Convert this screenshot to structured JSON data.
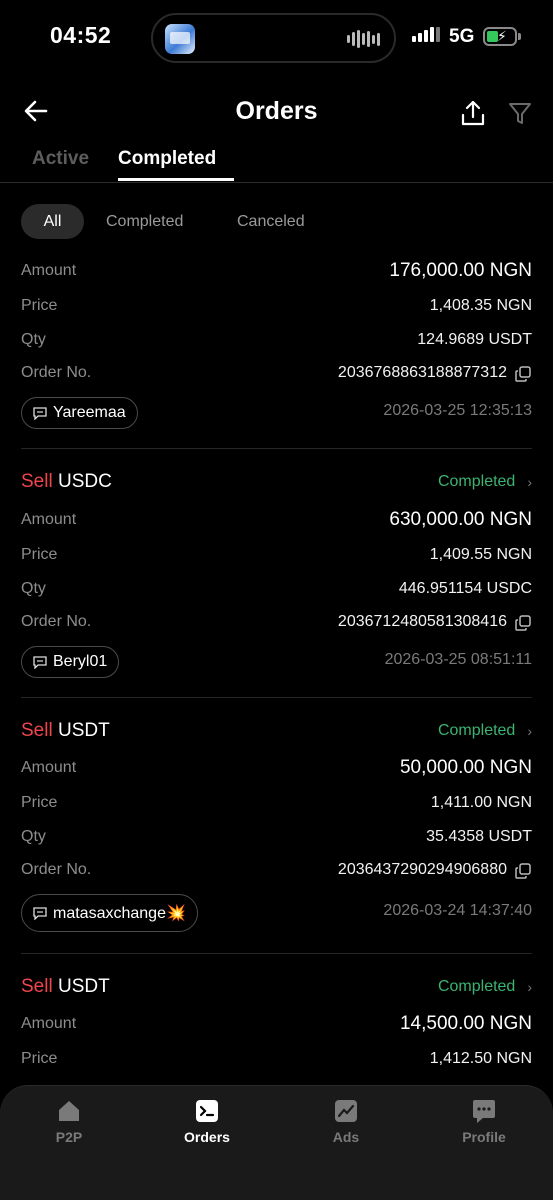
{
  "status_bar": {
    "time": "04:52",
    "network": "5G"
  },
  "header": {
    "title": "Orders"
  },
  "tabs": [
    {
      "label": "Active"
    },
    {
      "label": "Completed"
    }
  ],
  "chips": [
    {
      "label": "All"
    },
    {
      "label": "Completed"
    },
    {
      "label": "Canceled"
    }
  ],
  "labels": {
    "amount": "Amount",
    "price": "Price",
    "qty": "Qty",
    "order_no": "Order No."
  },
  "orders": [
    {
      "amount": "176,000.00 NGN",
      "price": "1,408.35 NGN",
      "qty": "124.9689 USDT",
      "order_no": "2036768863188877312",
      "merchant": "Yareemaa",
      "date": "2026-03-25 12:35:13"
    },
    {
      "side": "Sell",
      "asset": "USDC",
      "status": "Completed",
      "amount": "630,000.00 NGN",
      "price": "1,409.55 NGN",
      "qty": "446.951154 USDC",
      "order_no": "2036712480581308416",
      "merchant": "Beryl01",
      "date": "2026-03-25 08:51:11"
    },
    {
      "side": "Sell",
      "asset": "USDT",
      "status": "Completed",
      "amount": "50,000.00 NGN",
      "price": "1,411.00 NGN",
      "qty": "35.4358 USDT",
      "order_no": "2036437290294906880",
      "merchant": "matasaxchange💥",
      "date": "2026-03-24 14:37:40"
    },
    {
      "side": "Sell",
      "asset": "USDT",
      "status": "Completed",
      "amount": "14,500.00 NGN",
      "price": "1,412.50 NGN"
    }
  ],
  "nav": [
    {
      "label": "P2P"
    },
    {
      "label": "Orders"
    },
    {
      "label": "Ads"
    },
    {
      "label": "Profile"
    }
  ],
  "colors": {
    "sell": "#f0454d",
    "completed": "#3cb371",
    "background": "#000000"
  }
}
